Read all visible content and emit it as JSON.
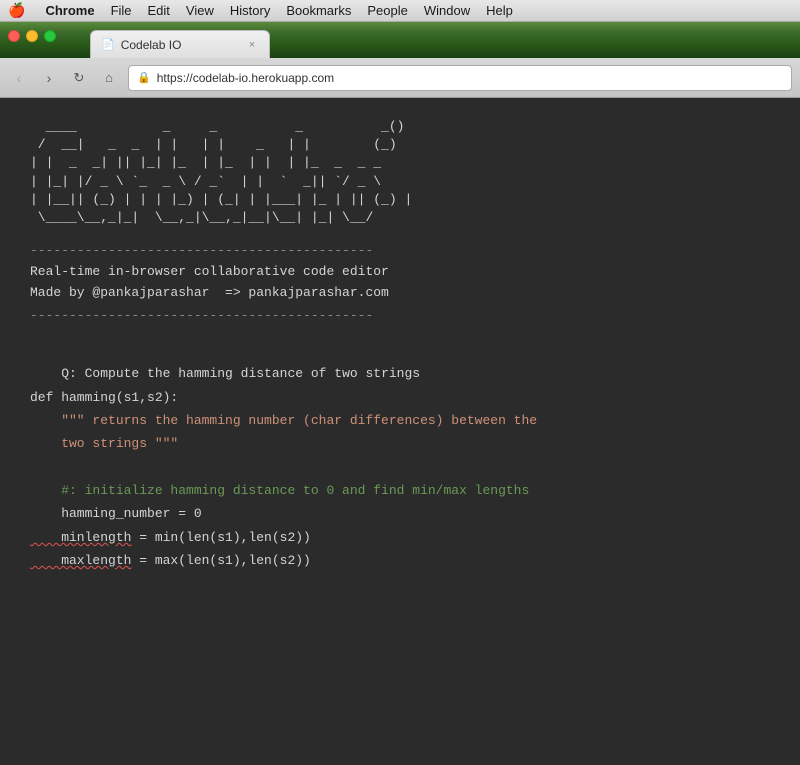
{
  "menubar": {
    "apple": "🍎",
    "items": [
      "Chrome",
      "File",
      "Edit",
      "View",
      "History",
      "Bookmarks",
      "People",
      "Window",
      "Help"
    ]
  },
  "tab": {
    "favicon": "📄",
    "title": "Codelab IO",
    "close": "×"
  },
  "toolbar": {
    "back": "‹",
    "forward": "›",
    "reload": "↻",
    "home": "⌂",
    "url": "https://codelab-io.herokuapp.com",
    "lock": "🔒"
  },
  "content": {
    "separator": "--------------------------------------------",
    "info_line1": "Real-time in-browser collaborative code editor",
    "info_line2": "Made by @pankajparashar  => pankajparashar.com",
    "code_question": "Q: Compute the hamming distance of two strings",
    "code_def": "def hamming(s1,s2):",
    "code_docstring1": "    \"\"\" returns the hamming number (char differences) between the",
    "code_docstring2": "    two strings \"\"\"",
    "code_comment": "    #: initialize hamming distance to 0 and find min/max lengths",
    "code_line1": "    hamming_number = 0",
    "code_line2_label": "    minlength",
    "code_line2_rest": " = min(len(s1),len(s2))",
    "code_line3_label": "    maxlength",
    "code_line3_rest": " = max(len(s1),len(s2))"
  },
  "ascii_art": {
    "line1": "  ____           _     _          _          _()",
    "line2": " /  __|   _  _  | |   | |    _   | |        (_)",
    "line3": "| |  _  _| || |_| |_  | |_  | |  | |_  _  _ _",
    "line4": "| |_| |/ _ \\ `_  _ \\ / _`  | |  `  _|| `/ _ \\",
    "line5": "| |__|| (_) | | | |_) | (_| | |___| |_ | || (_) |",
    "line6": " \\___|\\_,_|_|  \\__,_|\\__,_|__|\\__| |_| \\__/"
  }
}
